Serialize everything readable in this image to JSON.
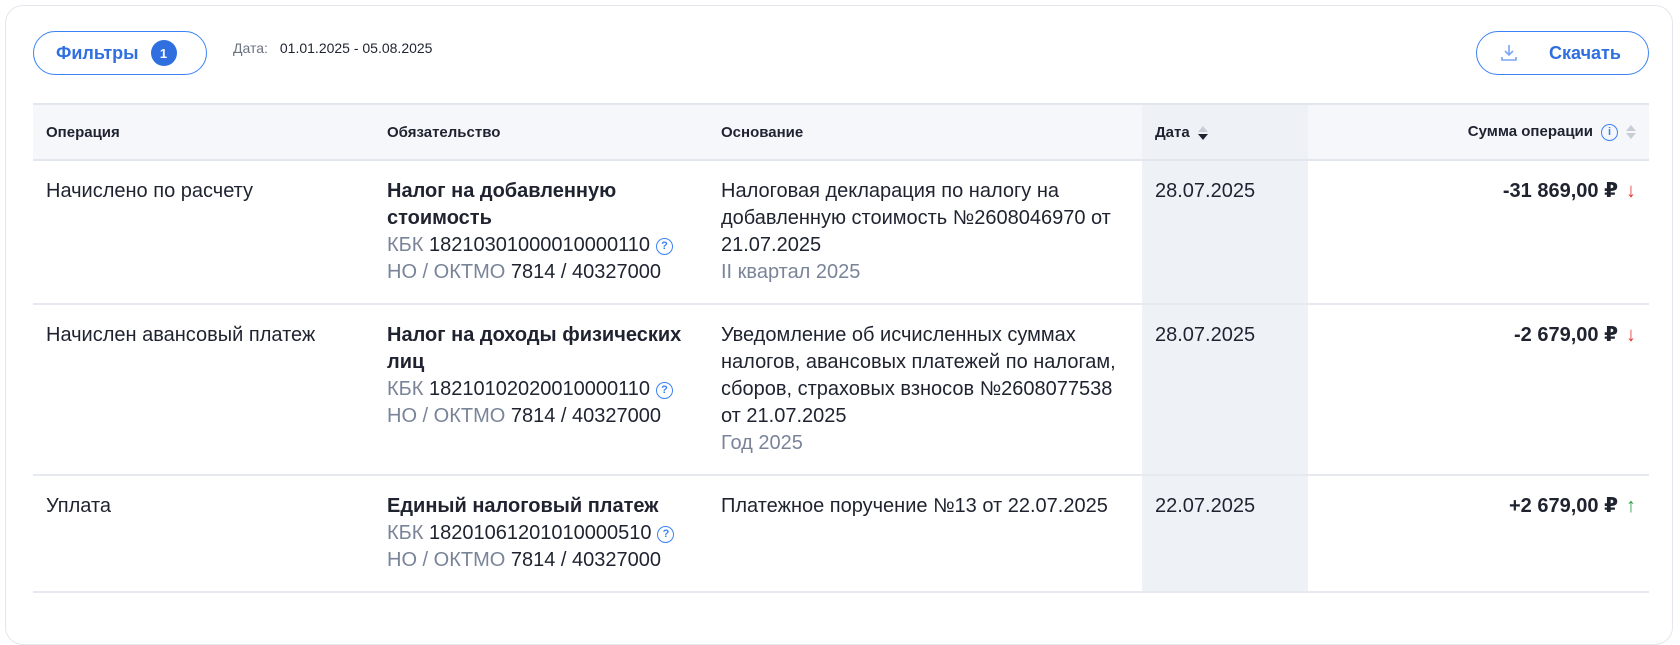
{
  "toolbar": {
    "filters_label": "Фильтры",
    "filters_count": "1",
    "date_label": "Дата:",
    "date_range": "01.01.2025 - 05.08.2025",
    "download_label": "Скачать"
  },
  "table": {
    "headers": {
      "operation": "Операция",
      "obligation": "Обязательство",
      "basis": "Основание",
      "date": "Дата",
      "amount": "Сумма операции"
    },
    "rows": [
      {
        "operation": "Начислено по расчету",
        "obligation": "Налог на добавленную стоимость",
        "kbk_label": "КБК",
        "kbk": "18210301000010000110",
        "no_label": "НО / ОКТМО",
        "no": "7814 / 40327000",
        "basis": "Налоговая декларация по налогу на добавленную стоимость №2608046970 от 21.07.2025",
        "period": "II квартал 2025",
        "date": "28.07.2025",
        "amount": "-31 869,00 ₽",
        "arrow": "↓"
      },
      {
        "operation": "Начислен авансовый платеж",
        "obligation": "Налог на доходы физических лиц",
        "kbk_label": "КБК",
        "kbk": "18210102020010000110",
        "no_label": "НО / ОКТМО",
        "no": "7814 / 40327000",
        "basis": "Уведомление об исчисленных суммах налогов, авансовых платежей по налогам, сборов, страховых взносов №2608077538 от 21.07.2025",
        "period": "Год 2025",
        "date": "28.07.2025",
        "amount": "-2 679,00 ₽",
        "arrow": "↓"
      },
      {
        "operation": "Уплата",
        "obligation": "Единый налоговый платеж",
        "kbk_label": "КБК",
        "kbk": "18201061201010000510",
        "no_label": "НО / ОКТМО",
        "no": "7814 / 40327000",
        "basis": "Платежное поручение №13 от 22.07.2025",
        "period": "",
        "date": "22.07.2025",
        "amount": "+2 679,00 ₽",
        "arrow": "↑"
      }
    ]
  },
  "colors": {
    "accent": "#3b82f6",
    "negative": "#e53935",
    "positive": "#2e9e4a"
  }
}
